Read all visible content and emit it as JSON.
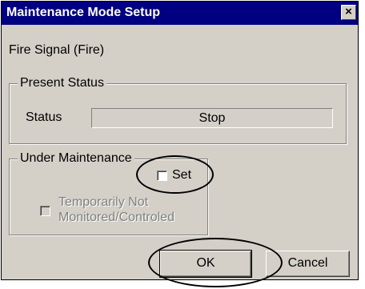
{
  "window": {
    "title": "Maintenance Mode Setup",
    "close_label": "×"
  },
  "signal_label": "Fire Signal  (Fire)",
  "present_status": {
    "legend": "Present Status",
    "status_label": "Status",
    "status_value": "Stop"
  },
  "under_maintenance": {
    "legend": "Under Maintenance",
    "set_label": "Set",
    "set_checked": false,
    "temp_label_line1": "Temporarily Not",
    "temp_label_line2": "Monitored/Controled",
    "temp_checked": false,
    "temp_enabled": false
  },
  "buttons": {
    "ok": "OK",
    "cancel": "Cancel"
  },
  "annotation_color": "#000000"
}
